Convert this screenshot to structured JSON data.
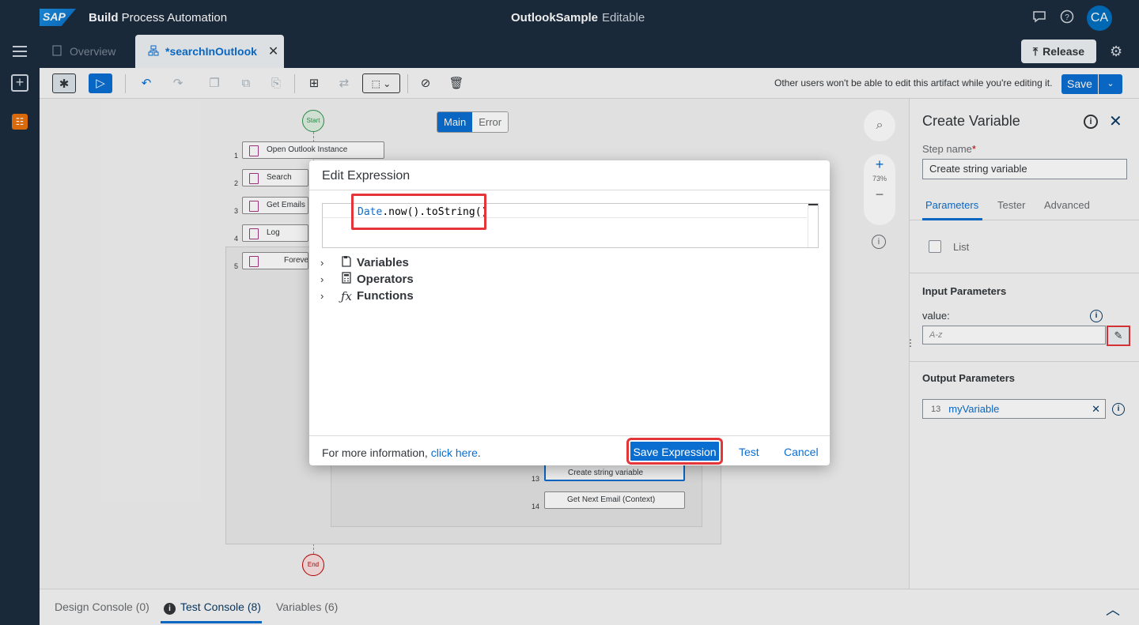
{
  "shell": {
    "logo_text": "SAP",
    "product_bold": "Build",
    "product_rest": " Process Automation",
    "project_name": "OutlookSample",
    "project_state": "Editable",
    "avatar_initials": "CA",
    "icons": [
      "feedback-icon",
      "help-icon"
    ]
  },
  "tabs": {
    "overview_label": "Overview",
    "active_label": "*searchInOutlook",
    "release_label": "Release"
  },
  "toolbar": {
    "note": "Other users won't be able to edit this artifact while you're editing it.",
    "save_label": "Save"
  },
  "canvas": {
    "start_label": "Start",
    "end_label": "End",
    "segment_main": "Main",
    "segment_error": "Error",
    "zoom_label": "73%",
    "steps": [
      {
        "num": "1",
        "label": "Open Outlook Instance"
      },
      {
        "num": "2",
        "label": "Search Emails"
      },
      {
        "num": "3",
        "label": "Get Emails N"
      },
      {
        "num": "4",
        "label": "Log Message"
      },
      {
        "num": "5",
        "label": "Forever"
      }
    ],
    "inner_steps": [
      {
        "num": "13",
        "label": "Create string variable"
      },
      {
        "num": "14",
        "label": "Get Next Email (Context)"
      }
    ]
  },
  "panel": {
    "title": "Create Variable",
    "step_name_label": "Step name",
    "step_name_required": "*",
    "step_name_value": "Create string variable",
    "tabs": [
      "Parameters",
      "Tester",
      "Advanced"
    ],
    "list_label": "List",
    "input_section": "Input Parameters",
    "value_label": "value:",
    "value_placeholder": "A-z",
    "output_section": "Output Parameters",
    "output_num": "13",
    "output_name": "myVariable"
  },
  "console": {
    "tabs": [
      "Design Console (0)",
      "Test Console (8)",
      "Variables (6)"
    ]
  },
  "dialog": {
    "title": "Edit Expression",
    "code_keyword": "Date",
    "code_rest": ".now().toString()",
    "tree": [
      {
        "label": "Variables",
        "icon": "variables-icon"
      },
      {
        "label": "Operators",
        "icon": "calculator-icon"
      },
      {
        "label": "Functions",
        "icon": "function-icon"
      }
    ],
    "footer_text": "For more information, ",
    "footer_link": "click here",
    "footer_period": ".",
    "save_label": "Save Expression",
    "test_label": "Test",
    "cancel_label": "Cancel"
  }
}
